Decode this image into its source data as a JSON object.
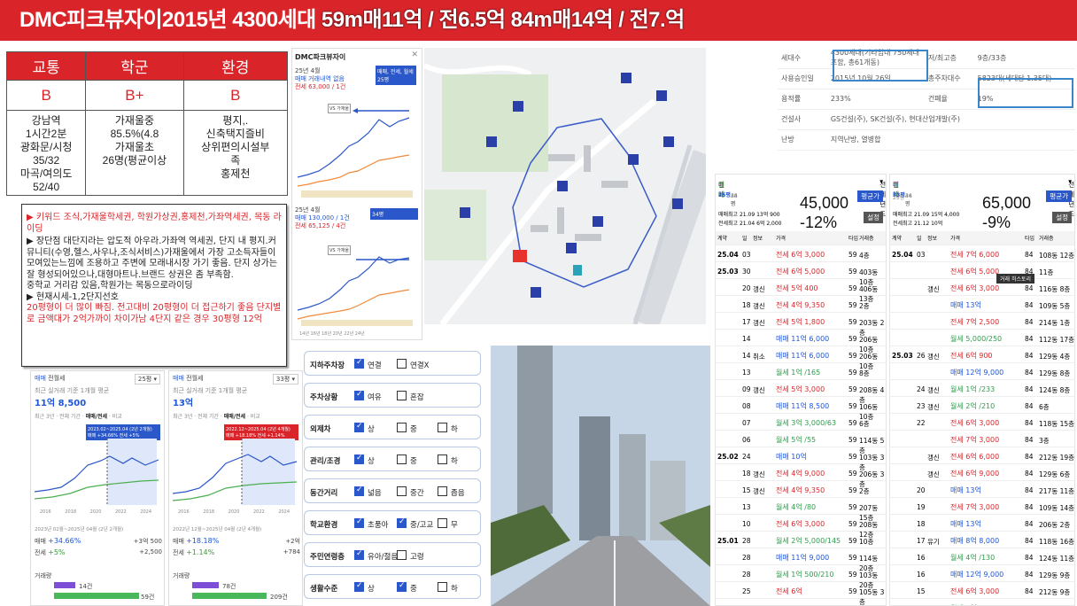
{
  "banner": {
    "title_a": "DMC피크뷰자이2015년 4300세대 ",
    "title_b": "59m매11억 / 전6.5억 84m매14억 / 전7.억"
  },
  "rating": {
    "headers": [
      "교통",
      "학군",
      "환경"
    ],
    "grades": [
      "B",
      "B+",
      "B"
    ],
    "desc": [
      "강남역\n1시간2분\n광화문/시청\n35/32\n마곡/여의도\n52/40",
      "가재울중\n85.5%(4.8\n가재울초\n26명(평균이상",
      "평지,.\n신축택지즐비\n상위편의시설부\n족\n홍제천"
    ]
  },
  "notes": {
    "l1": "▶ 키워드 조식,가재울학세권, 학원가상권,홍제천,가좌역세권, 목동 라이딩",
    "l2": "▶ 장단점 대단지라는 압도적 아우라.가좌역 역세권, 단지 내 평지.커뮤니티(수영,헬스,사우나,조식서비스)가재울에서 가장 고소득자들이 모여있는느낌에 조용하고 주변에 모래내시장 가기 좋음. 단지 상가는 잘 형성되어있으나,대형마트나.브랜드 상권은 좀 부족함.",
    "l3": "중학교 거리감 있음,학원가는 목동으로라이딩",
    "l4": "▶ 현재시세-1,2단지선호",
    "l5": "20평형이 더 많이 빠짐. 전고대비 20평형이 더 접근하기 좋음 단지별로 금액대가 2억가까이 차이가남 4단지 같은 경우 30평형 12억"
  },
  "chartpanel": {
    "title": "DMC파크뷰자이",
    "c1_head": "25년 4월",
    "c1_line": "매매 거래내역 없음",
    "c1_sub": "전세 63,000 / 1건",
    "c1_tag": "VS 가재울",
    "c2_head": "25년 4월",
    "c2_line": "매매 130,000 / 1건",
    "c2_sub": "전세 65,125 / 4건",
    "c2_tag": "VS 가재울",
    "legend_a": "매매, 전세, 월세",
    "legend_b": "25평",
    "legend_c": "34평",
    "foot": "14년 16년 18년 20년 22년 24년"
  },
  "map": {
    "labels": [
      "13억",
      "13억",
      "12억",
      "11억",
      "12억",
      "13억",
      "11억",
      "14억",
      "13억"
    ]
  },
  "small1": {
    "tabs": [
      "매매",
      "전월세"
    ],
    "sel": "25평",
    "cap": "최근 실거래 기준 1개월 평균",
    "price": "11억 8,500",
    "tabs2": [
      "최근 3년",
      "전체 기간",
      "매매/전세",
      "비교"
    ],
    "tip": "2023.02~2025.04 (2년 2개월)\n매매 +34.66% 전세 +5%",
    "period": "2023년 02월~2025년 04월 (2년 2개월)",
    "row1_label": "매매",
    "row1_val": "+34.66%",
    "row1_amt": "+3억 500",
    "row2_label": "전세",
    "row2_val": "+5%",
    "row2_amt": "+2,500",
    "vol": "거래량",
    "v1": "14건",
    "v2": "59건",
    "x_labels": [
      "2016",
      "2018",
      "2020",
      "2022",
      "2024"
    ]
  },
  "small2": {
    "tabs": [
      "매매",
      "전월세"
    ],
    "sel": "33평",
    "cap": "최근 실거래 기준 1개월 평균",
    "price": "13억",
    "tabs2": [
      "최근 3년",
      "전체 기간",
      "매매/전세",
      "비교"
    ],
    "tip": "2022.12~2025.04 (2년 4개월)\n매매 +18.18% 전세 +1.14%",
    "period": "2022년 12월~2025년 04월 (2년 4개월)",
    "row1_label": "매매",
    "row1_val": "+18.18%",
    "row1_amt": "+2억",
    "row2_label": "전세",
    "row2_val": "+1.14%",
    "row2_amt": "+784",
    "vol": "거래량",
    "v1": "78건",
    "v2": "209건",
    "x_labels": [
      "2016",
      "2018",
      "2020",
      "2022",
      "2024"
    ]
  },
  "form": [
    {
      "label": "지하주차장",
      "opts": [
        {
          "t": "연결",
          "on": true
        },
        {
          "t": "연결X",
          "on": false
        }
      ]
    },
    {
      "label": "주차상황",
      "opts": [
        {
          "t": "여유",
          "on": true
        },
        {
          "t": "혼잡",
          "on": false
        }
      ]
    },
    {
      "label": "외제차",
      "opts": [
        {
          "t": "상",
          "on": true
        },
        {
          "t": "중",
          "on": false
        },
        {
          "t": "하",
          "on": false
        }
      ]
    },
    {
      "label": "관리/조경",
      "opts": [
        {
          "t": "상",
          "on": true
        },
        {
          "t": "중",
          "on": false
        },
        {
          "t": "하",
          "on": false
        }
      ]
    },
    {
      "label": "동간거리",
      "opts": [
        {
          "t": "넓음",
          "on": true
        },
        {
          "t": "중간",
          "on": false
        },
        {
          "t": "좁음",
          "on": false
        }
      ]
    },
    {
      "label": "학교환경",
      "opts": [
        {
          "t": "초품아",
          "on": true
        },
        {
          "t": "중/고교",
          "on": true
        },
        {
          "t": "무",
          "on": false
        }
      ]
    },
    {
      "label": "주민연령층",
      "opts": [
        {
          "t": "유아/젊음",
          "on": true
        },
        {
          "t": "고령",
          "on": false
        }
      ]
    },
    {
      "label": "생활수준",
      "opts": [
        {
          "t": "상",
          "on": true
        },
        {
          "t": "중",
          "on": true
        },
        {
          "t": "하",
          "on": false
        }
      ]
    }
  ],
  "info": {
    "rows": [
      [
        "세대수",
        "4300세대(기타임대 750세대 포함, 총61개동)",
        "저/최고층",
        "9층/33층"
      ],
      [
        "사용승인일",
        "2015년 10월 26일",
        "총주차대수",
        "5823대(세대당 1.35대)"
      ],
      [
        "용적률",
        "233%",
        "건폐율",
        "19%"
      ],
      [
        "건설사",
        "GS건설(주), SK건설(주), 현대산업개발(주)",
        "",
        ""
      ],
      [
        "난방",
        "지역난방, 열병합",
        "",
        ""
      ]
    ]
  },
  "tx1": {
    "tabs": [
      "매매",
      "전세",
      "월세"
    ],
    "filter": "전체년도",
    "size_tabs": [
      "25평",
      "33평",
      "34평",
      "36평",
      "44평"
    ],
    "big_price": "45,000",
    "big_pct": "-12%",
    "hi1": "매매최고 21.09 13억 900",
    "hi2": "전세최고 21.04 6억 2,000",
    "btn1": "평균가",
    "btn2": "설정",
    "cols": [
      "계약",
      "일",
      "정보",
      "가격",
      "타입",
      "거래층"
    ],
    "rows": [
      [
        "25.04",
        "03",
        "",
        "전세 6억 3,000",
        "59",
        "4층"
      ],
      [
        "25.03",
        "30",
        "",
        "전세 6억 5,000",
        "59",
        "403동 10층"
      ],
      [
        "",
        "20",
        "갱신",
        "전세 5억 400",
        "59",
        "406동 13층"
      ],
      [
        "",
        "18",
        "갱신",
        "전세 4억 9,350",
        "59",
        "2층"
      ],
      [
        "",
        "17",
        "갱신",
        "전세 5억 1,800",
        "59",
        "203동 2층"
      ],
      [
        "",
        "14",
        "",
        "매매 11억 6,000",
        "59",
        "206동 10층"
      ],
      [
        "",
        "14",
        "취소",
        "매매 11억 6,000",
        "59",
        "206동 10층"
      ],
      [
        "",
        "13",
        "",
        "월세 1억 /165",
        "59",
        "8층"
      ],
      [
        "",
        "09",
        "갱신",
        "전세 5억 3,000",
        "59",
        "208동 4층"
      ],
      [
        "",
        "08",
        "",
        "매매 11억 8,500",
        "59",
        "106동 10층"
      ],
      [
        "",
        "07",
        "",
        "월세 3억 3,000/63",
        "59",
        "6층"
      ],
      [
        "",
        "06",
        "",
        "월세 5억 /55",
        "59",
        "114동 5층"
      ],
      [
        "25.02",
        "24",
        "",
        "매매 10억",
        "59",
        "103동 3층"
      ],
      [
        "",
        "18",
        "갱신",
        "전세 4억 9,000",
        "59",
        "206동 3층"
      ],
      [
        "",
        "15",
        "갱신",
        "전세 4억 9,350",
        "59",
        "2층"
      ],
      [
        "",
        "13",
        "",
        "월세 4억 /80",
        "59",
        "207동 15층"
      ],
      [
        "",
        "10",
        "",
        "전세 6억 3,000",
        "59",
        "208동 12층"
      ],
      [
        "25.01",
        "28",
        "",
        "월세 2억 5,000/145",
        "59",
        "10층"
      ],
      [
        "",
        "28",
        "",
        "매매 11억 9,000",
        "59",
        "114동 20층"
      ],
      [
        "",
        "28",
        "",
        "월세 1억 500/210",
        "59",
        "103동 20층"
      ],
      [
        "",
        "25",
        "",
        "전세 6억",
        "59",
        "105동 3층"
      ]
    ]
  },
  "tx2": {
    "tabs": [
      "매매",
      "전세",
      "월세"
    ],
    "filter": "전체년도",
    "size_tabs": [
      "25평",
      "33평",
      "34평",
      "36평",
      "44평"
    ],
    "big_price": "65,000",
    "big_pct": "-9%",
    "hi1": "매매최고 21.09 15억 4,000",
    "hi2": "전세최고 21.12 10억",
    "btn1": "평균가",
    "btn2": "설정",
    "cols": [
      "계약",
      "일",
      "정보",
      "가격",
      "타입",
      "거래층"
    ],
    "tooltip": "거래 히스토리",
    "rows": [
      [
        "25.04",
        "03",
        "",
        "전세 7억 6,000",
        "84",
        "108동 12층"
      ],
      [
        "",
        "",
        "",
        "전세 6억 5,000",
        "84",
        "11층"
      ],
      [
        "",
        "",
        "갱신",
        "전세 6억 3,000",
        "84",
        "116동 8층"
      ],
      [
        "",
        "",
        "",
        "매매 13억",
        "84",
        "109동 5층"
      ],
      [
        "",
        "",
        "",
        "전세 7억 2,500",
        "84",
        "214동 1층"
      ],
      [
        "",
        "",
        "",
        "월세 5,000/250",
        "84",
        "112동 17층"
      ],
      [
        "25.03",
        "26",
        "갱신",
        "전세 6억 900",
        "84",
        "129동 4층"
      ],
      [
        "",
        "",
        "",
        "매매 12억 9,000",
        "84",
        "129동 8층"
      ],
      [
        "",
        "24",
        "갱신",
        "월세 1억 /233",
        "84",
        "124동 8층"
      ],
      [
        "",
        "23",
        "갱신",
        "월세 2억 /210",
        "84",
        "6층"
      ],
      [
        "",
        "22",
        "",
        "전세 6억 3,000",
        "84",
        "118동 15층"
      ],
      [
        "",
        "",
        "",
        "전세 7억 3,000",
        "84",
        "3층"
      ],
      [
        "",
        "",
        "갱신",
        "전세 6억 6,000",
        "84",
        "212동 19층"
      ],
      [
        "",
        "",
        "갱신",
        "전세 6억 9,000",
        "84",
        "129동 6층"
      ],
      [
        "",
        "20",
        "",
        "매매 13억",
        "84",
        "217동 11층"
      ],
      [
        "",
        "19",
        "",
        "전세 7억 3,000",
        "84",
        "109동 14층"
      ],
      [
        "",
        "18",
        "",
        "매매 13억",
        "84",
        "206동 2층"
      ],
      [
        "",
        "17",
        "유기",
        "매매 8억 8,000",
        "84",
        "118동 16층"
      ],
      [
        "",
        "16",
        "",
        "월세 4억 /130",
        "84",
        "124동 11층"
      ],
      [
        "",
        "16",
        "",
        "매매 12억 9,000",
        "84",
        "129동 9층"
      ],
      [
        "",
        "15",
        "",
        "전세 6억 3,000",
        "84",
        "212동 9층"
      ],
      [
        "",
        "11",
        "",
        "월세 2억 /220",
        "84",
        "215동 13층"
      ]
    ]
  }
}
